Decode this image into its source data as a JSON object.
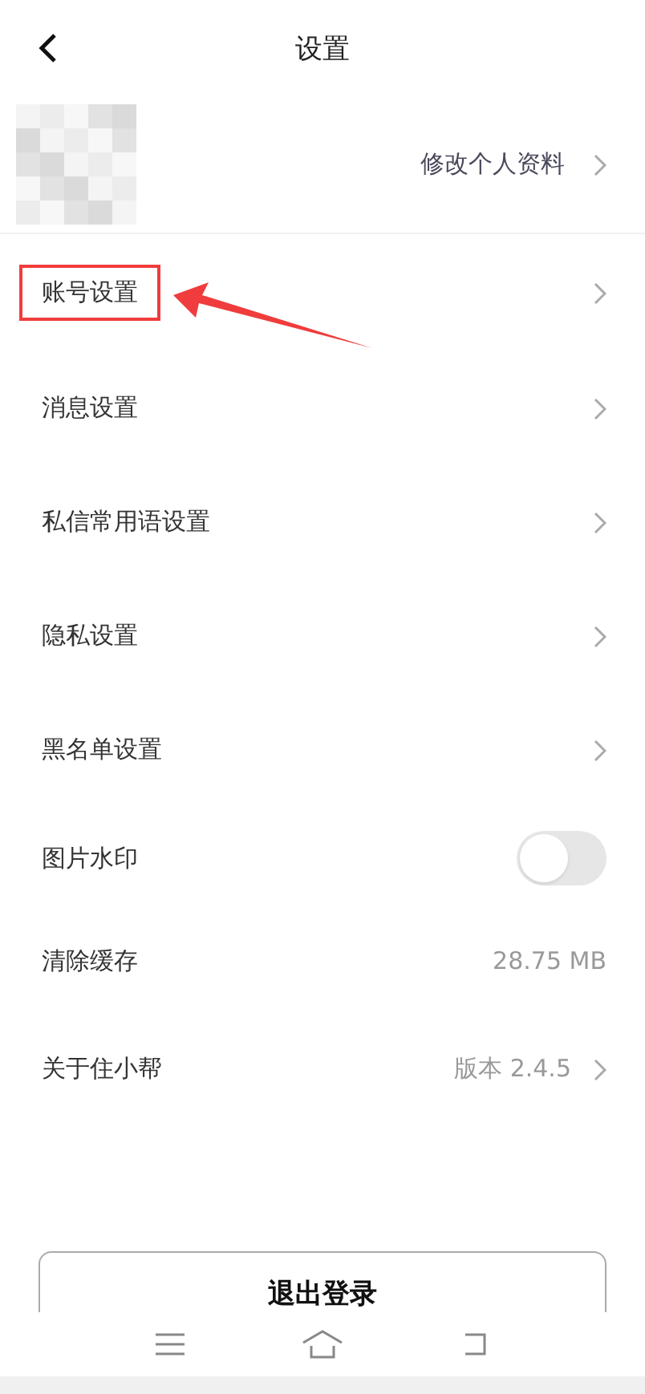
{
  "header": {
    "title": "设置"
  },
  "profile": {
    "kind": "picture",
    "link": "修改个人资料"
  },
  "items": [
    {
      "kind": "link",
      "label": "账号设置",
      "highlighted": true
    },
    {
      "kind": "link",
      "label": "消息设置",
      "highlighted": false
    },
    {
      "kind": "link",
      "label": "私信常用语设置",
      "highlighted": false
    },
    {
      "kind": "link",
      "label": "隐私设置",
      "highlighted": false
    },
    {
      "kind": "link",
      "label": "黑名单设置",
      "highlighted": false
    },
    {
      "kind": "toggle",
      "label": "图片水印",
      "on": false,
      "highlighted": false
    },
    {
      "kind": "value",
      "label": "清除缓存",
      "value": "28.75 MB",
      "highlighted": false
    },
    {
      "kind": "link",
      "label": "关于住小帮",
      "value": "版本 2.4.5",
      "highlighted": false
    }
  ],
  "logout_button": "退出登录"
}
